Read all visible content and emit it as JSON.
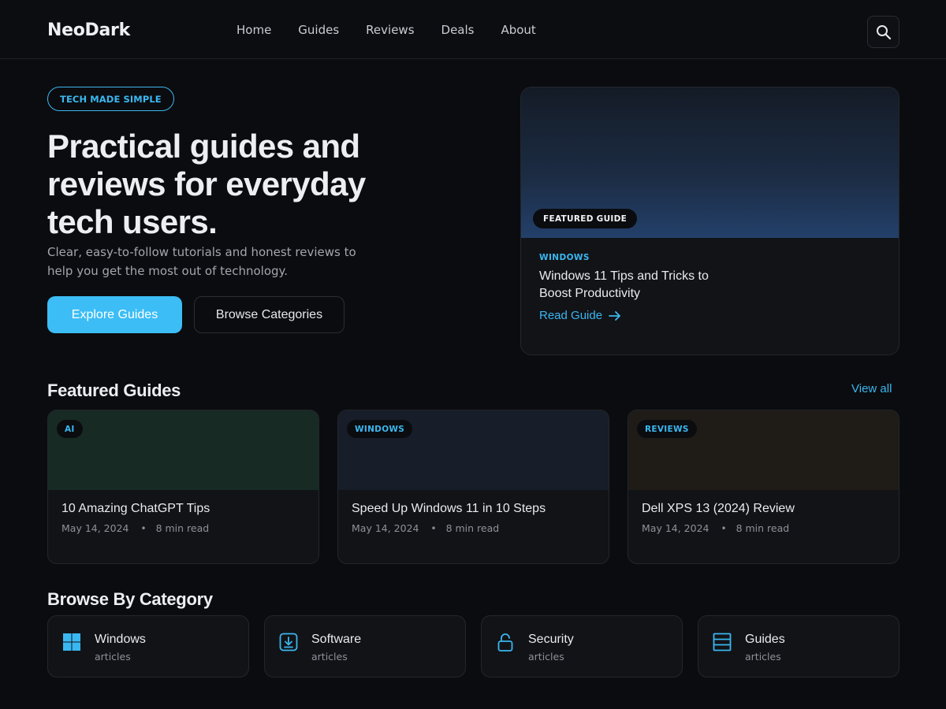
{
  "header": {
    "brand": "NeoDark",
    "nav": [
      "Home",
      "Guides",
      "Reviews",
      "Deals",
      "About"
    ],
    "search_icon": "search-icon"
  },
  "hero": {
    "pill": "TECH MADE SIMPLE",
    "title": "Practical guides and reviews for everyday tech users.",
    "subtitle": "Clear, easy-to-follow tutorials and honest reviews to help you get the most out of technology.",
    "primary_button": "Explore Guides",
    "secondary_button": "Browse Categories"
  },
  "featured": {
    "badge": "FEATURED GUIDE",
    "category": "WINDOWS",
    "title": "Windows 11 Tips and Tricks to Boost Productivity",
    "link": "Read Guide"
  },
  "featured_guides": {
    "title": "Featured Guides",
    "view_all": "View all",
    "items": [
      {
        "badge": "AI",
        "title": "10 Amazing ChatGPT Tips",
        "date": "May 14, 2024",
        "read_time": "8 min read",
        "color": "#172a24"
      },
      {
        "badge": "WINDOWS",
        "title": "Speed Up Windows 11 in 10 Steps",
        "date": "May 14, 2024",
        "read_time": "8 min read",
        "color": "#171d29"
      },
      {
        "badge": "REVIEWS",
        "title": "Dell XPS 13 (2024) Review",
        "date": "May 14, 2024",
        "read_time": "8 min read",
        "color": "#1f1b17"
      }
    ]
  },
  "categories": {
    "title": "Browse By Category",
    "items": [
      {
        "name": "Windows",
        "sub": "articles",
        "icon": "windows-icon"
      },
      {
        "name": "Software",
        "sub": "articles",
        "icon": "download-icon"
      },
      {
        "name": "Security",
        "sub": "articles",
        "icon": "lock-icon"
      },
      {
        "name": "Guides",
        "sub": "articles",
        "icon": "list-icon"
      }
    ]
  },
  "colors": {
    "accent": "#3ab7f0",
    "background": "#0b0c0f",
    "card": "#121317"
  }
}
